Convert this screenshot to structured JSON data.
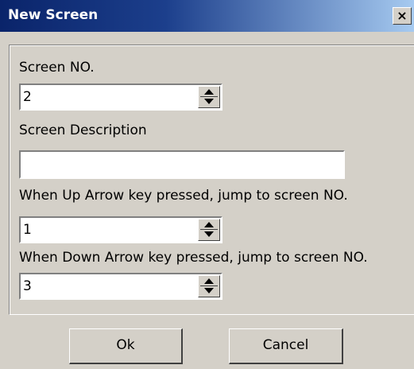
{
  "window": {
    "title": "New Screen",
    "close_symbol": "×"
  },
  "form": {
    "screen_no_label": "Screen NO.",
    "screen_no_value": "2",
    "description_label": "Screen Description",
    "description_value": "",
    "up_label": "When Up Arrow key pressed, jump to screen NO.",
    "up_value": "1",
    "down_label": "When Down Arrow key pressed, jump to screen NO.",
    "down_value": "3"
  },
  "buttons": {
    "ok_label": "Ok",
    "cancel_label": "Cancel"
  },
  "icons": {
    "spin_up": "spin-up-arrow-icon",
    "spin_down": "spin-down-arrow-icon",
    "close": "close-icon"
  },
  "colors": {
    "titlebar": "#0a246a",
    "face": "#d4d0c8"
  }
}
